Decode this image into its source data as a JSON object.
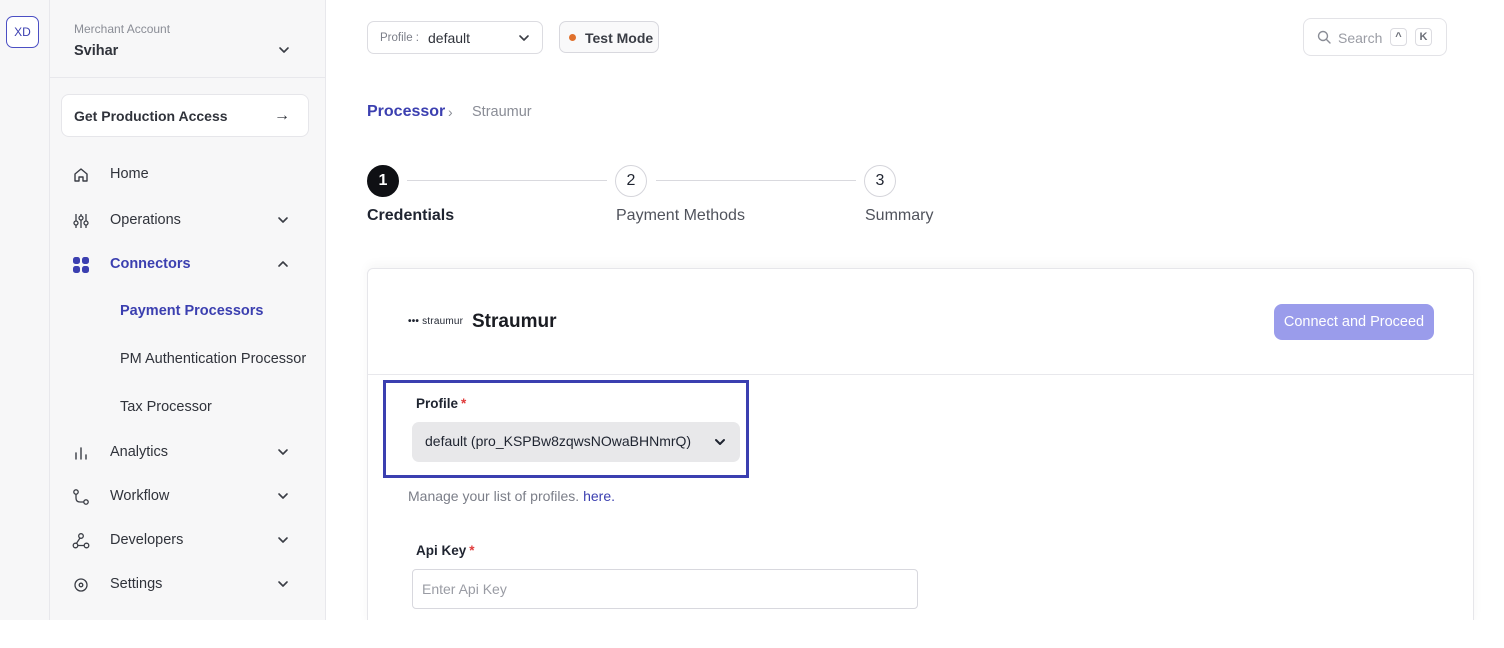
{
  "org": {
    "initials": "XD"
  },
  "sidebar": {
    "merchant_caption": "Merchant Account",
    "merchant_name": "Svihar",
    "production_access": "Get Production Access",
    "production_arrow": "→",
    "items": [
      {
        "label": "Home",
        "icon": "home-icon"
      },
      {
        "label": "Operations",
        "icon": "operations-icon"
      },
      {
        "label": "Connectors",
        "icon": "connectors-icon"
      },
      {
        "label": "Analytics",
        "icon": "analytics-icon"
      },
      {
        "label": "Workflow",
        "icon": "workflow-icon"
      },
      {
        "label": "Developers",
        "icon": "developers-icon"
      },
      {
        "label": "Settings",
        "icon": "settings-icon"
      }
    ],
    "connector_subitems": [
      {
        "label": "Payment Processors"
      },
      {
        "label": "PM Authentication Processor"
      },
      {
        "label": "Tax Processor"
      }
    ]
  },
  "topbar": {
    "profile_caption": "Profile :",
    "profile_value": "default",
    "test_mode": "Test Mode",
    "search_placeholder": "Search",
    "shortcut_1": "^",
    "shortcut_2": "K"
  },
  "breadcrumb": {
    "parent": "Processor",
    "separator": "›",
    "current": "Straumur"
  },
  "stepper": [
    {
      "number": "1",
      "label": "Credentials"
    },
    {
      "number": "2",
      "label": "Payment Methods"
    },
    {
      "number": "3",
      "label": "Summary"
    }
  ],
  "connector": {
    "logo_dots": "•••",
    "logo_text": "straumur",
    "title": "Straumur",
    "proceed_button": "Connect and Proceed"
  },
  "form": {
    "profile_label": "Profile",
    "required_mark": "*",
    "profile_value": "default (pro_KSPBw8zqwsNOwaBHNmrQ)",
    "help_text": "Manage your list of profiles.",
    "help_link": "here.",
    "api_key_label": "Api Key",
    "api_key_placeholder": "Enter Api Key",
    "api_key_value": ""
  },
  "colors": {
    "accent": "#3b3fb0",
    "proceed_button": "#9a9ceb",
    "test_mode_dot": "#e0702c",
    "required": "#e03b3b"
  }
}
